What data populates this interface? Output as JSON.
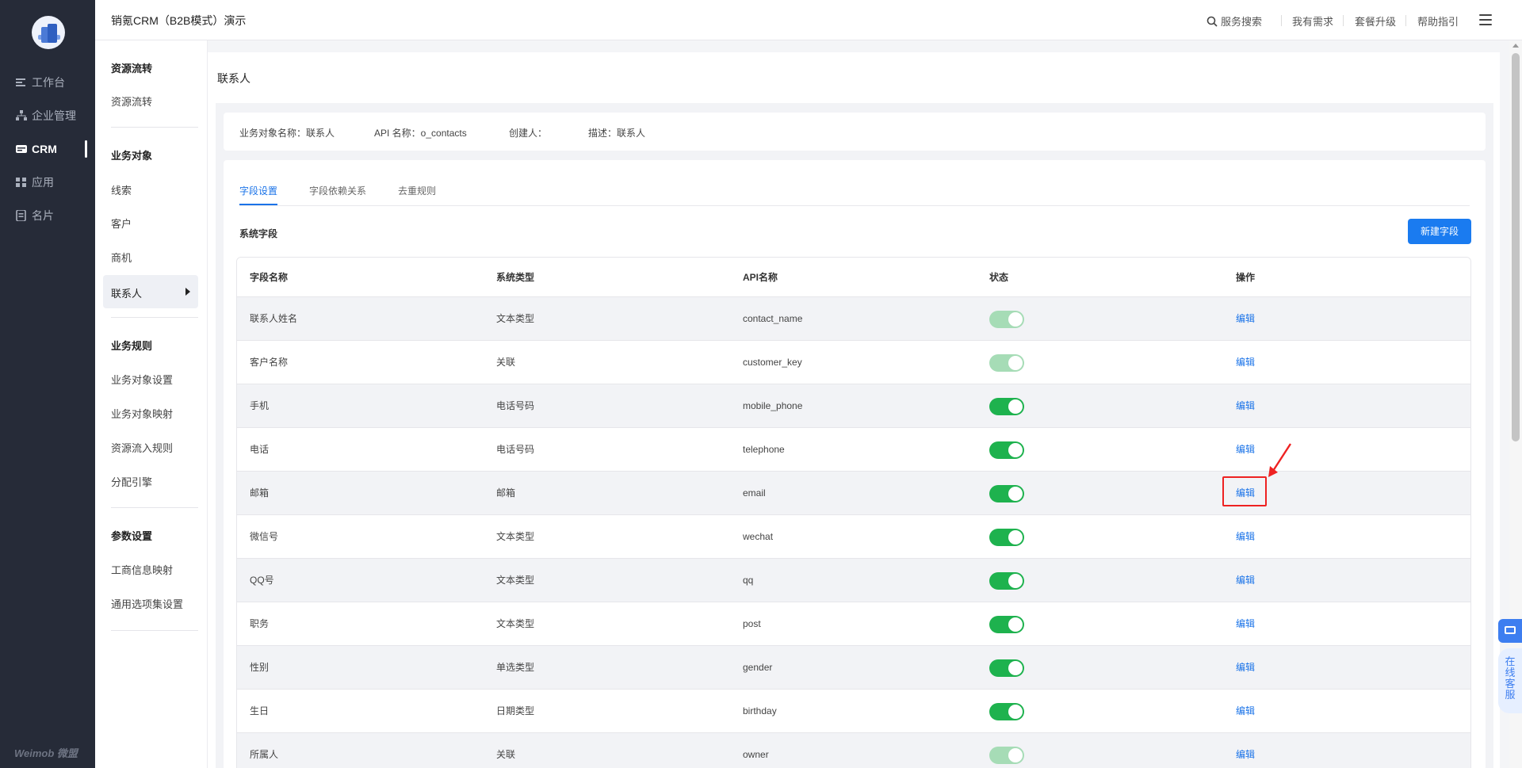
{
  "app": {
    "title": "销氪CRM（B2B模式）演示",
    "brand": "Weimob 微盟"
  },
  "rail": {
    "items": [
      {
        "label": "工作台",
        "icon": "dashboard-icon"
      },
      {
        "label": "企业管理",
        "icon": "org-icon"
      },
      {
        "label": "CRM",
        "icon": "crm-icon",
        "active": true
      },
      {
        "label": "应用",
        "icon": "apps-icon"
      },
      {
        "label": "名片",
        "icon": "card-icon"
      }
    ]
  },
  "topnav": {
    "search": "服务搜索",
    "needs": "我有需求",
    "upgrade": "套餐升级",
    "help": "帮助指引"
  },
  "sidebar": {
    "groups": [
      {
        "title": "资源流转",
        "items": [
          "资源流转"
        ]
      },
      {
        "title": "业务对象",
        "items": [
          "线索",
          "客户",
          "商机",
          "联系人"
        ]
      },
      {
        "title": "业务规则",
        "items": [
          "业务对象设置",
          "业务对象映射",
          "资源流入规则",
          "分配引擎"
        ]
      },
      {
        "title": "参数设置",
        "items": [
          "工商信息映射",
          "通用选项集设置"
        ]
      }
    ],
    "selected": "联系人"
  },
  "page": {
    "title": "联系人",
    "info": {
      "object_name": "业务对象名称：联系人",
      "api_name": "API 名称：o_contacts",
      "creator": "创建人：",
      "desc": "描述：联系人"
    },
    "tabs": [
      "字段设置",
      "字段依赖关系",
      "去重规则"
    ],
    "active_tab": "字段设置",
    "section": "系统字段",
    "new_button": "新建字段"
  },
  "table": {
    "headers": [
      "字段名称",
      "系统类型",
      "API名称",
      "状态",
      "操作"
    ],
    "rows": [
      {
        "name": "联系人姓名",
        "type": "文本类型",
        "api": "contact_name",
        "enabled": true,
        "locked": true,
        "action": "编辑"
      },
      {
        "name": "客户名称",
        "type": "关联",
        "api": "customer_key",
        "enabled": true,
        "locked": true,
        "action": "编辑"
      },
      {
        "name": "手机",
        "type": "电话号码",
        "api": "mobile_phone",
        "enabled": true,
        "locked": false,
        "action": "编辑"
      },
      {
        "name": "电话",
        "type": "电话号码",
        "api": "telephone",
        "enabled": true,
        "locked": false,
        "action": "编辑"
      },
      {
        "name": "邮箱",
        "type": "邮箱",
        "api": "email",
        "enabled": true,
        "locked": false,
        "action": "编辑"
      },
      {
        "name": "微信号",
        "type": "文本类型",
        "api": "wechat",
        "enabled": true,
        "locked": false,
        "action": "编辑"
      },
      {
        "name": "QQ号",
        "type": "文本类型",
        "api": "qq",
        "enabled": true,
        "locked": false,
        "action": "编辑"
      },
      {
        "name": "职务",
        "type": "文本类型",
        "api": "post",
        "enabled": true,
        "locked": false,
        "action": "编辑"
      },
      {
        "name": "性别",
        "type": "单选类型",
        "api": "gender",
        "enabled": true,
        "locked": false,
        "action": "编辑"
      },
      {
        "name": "生日",
        "type": "日期类型",
        "api": "birthday",
        "enabled": true,
        "locked": false,
        "action": "编辑"
      },
      {
        "name": "所属人",
        "type": "关联",
        "api": "owner",
        "enabled": true,
        "locked": true,
        "action": "编辑"
      }
    ]
  },
  "support": {
    "label": "在线客服"
  },
  "colors": {
    "accent": "#1a73e8",
    "toggle_on": "#1eb24e",
    "toggle_locked": "#a6dcb6",
    "rail_bg": "#262b38"
  }
}
